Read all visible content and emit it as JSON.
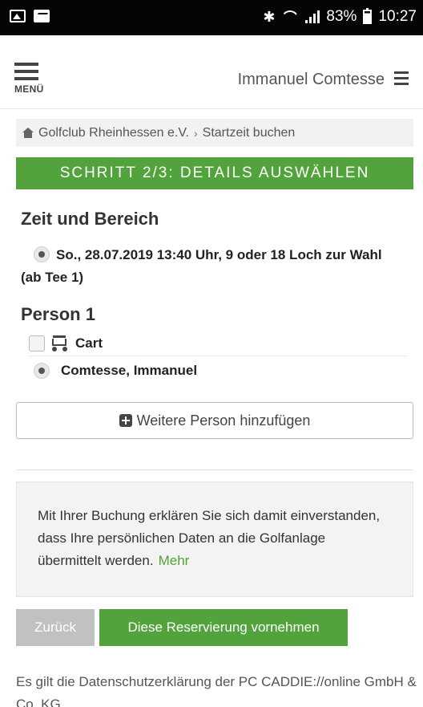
{
  "status_bar": {
    "battery": "83%",
    "time": "10:27",
    "icons": [
      "image-icon",
      "activity-icon",
      "bluetooth-icon",
      "wifi-icon",
      "signal-icon",
      "battery-icon"
    ]
  },
  "header": {
    "menu_label": "MENÜ",
    "user_name": "Immanuel Comtesse"
  },
  "breadcrumb": {
    "items": [
      "Golfclub Rheinhessen e.V.",
      "Startzeit buchen"
    ],
    "separator": "›"
  },
  "step_banner": "SCHRITT 2/3: DETAILS AUSWÄHLEN",
  "time_section": {
    "title": "Zeit und Bereich",
    "option": "So.,  28.07.2019 13:40 Uhr, 9 oder 18 Loch zur Wahl (ab Tee 1)"
  },
  "person_section": {
    "title": "Person 1",
    "cart_label": "Cart",
    "person_name": "Comtesse, Immanuel"
  },
  "add_person_label": "Weitere Person hinzufügen",
  "notice": {
    "text": "Mit Ihrer Buchung erklären Sie sich damit einverstanden, dass Ihre persönlichen Daten an die Golfanlage übermittelt werden.",
    "more": "Mehr"
  },
  "buttons": {
    "back": "Zurück",
    "reserve": "Diese Reservierung vornehmen"
  },
  "footer_note": "Es gilt die Datenschutzerklärung der PC CADDIE://online GmbH & Co. KG.",
  "colors": {
    "accent_green": "#52a33b",
    "status_bar": "#050505",
    "back_button": "#c1c1c1"
  }
}
